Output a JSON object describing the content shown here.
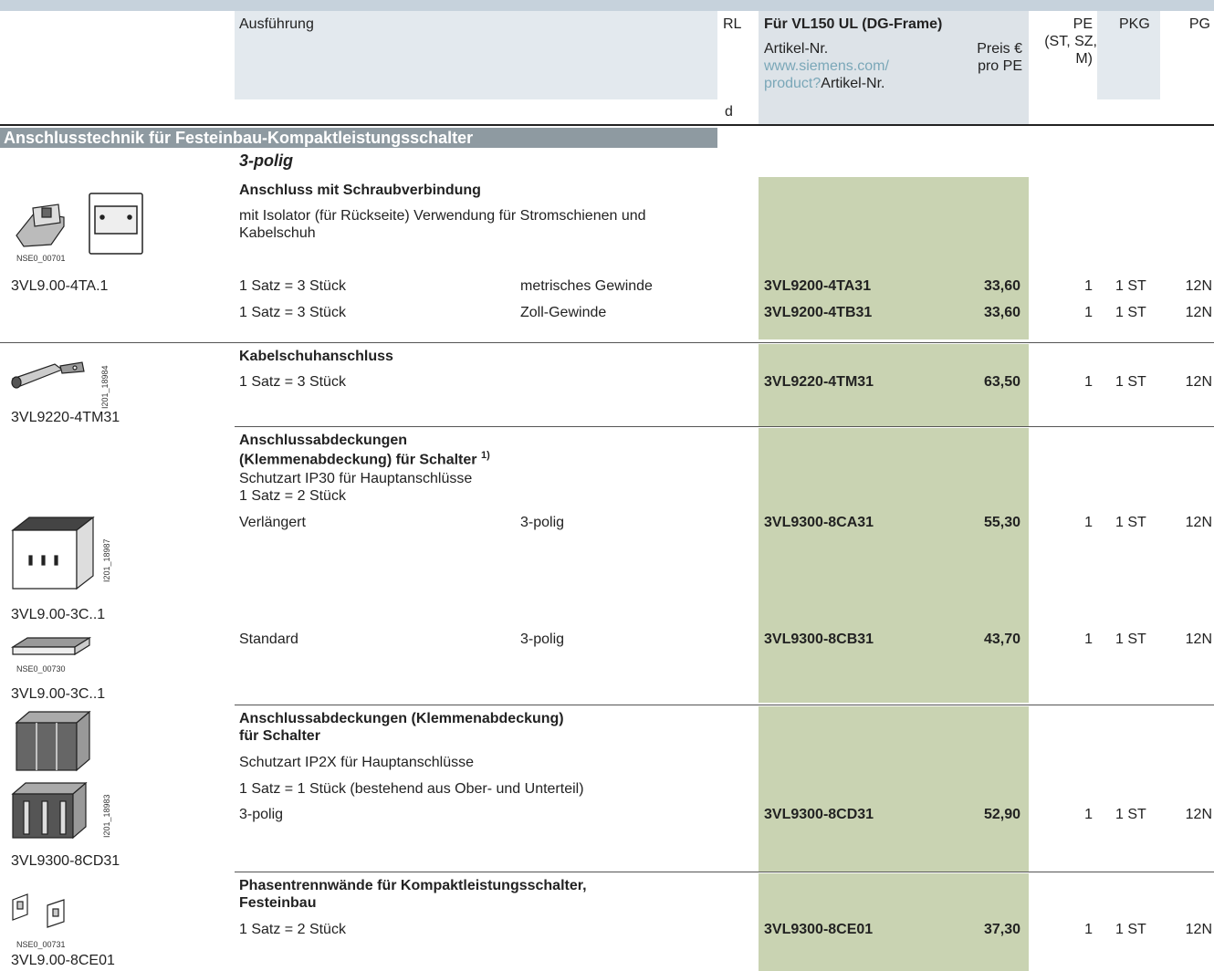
{
  "header": {
    "col_ausfuehrung": "Ausführung",
    "col_rl": "RL",
    "col_rl_d": "d",
    "frame_title": "Für VL150 UL (DG-Frame)",
    "artikel_nr": "Artikel-Nr.",
    "preis_line1": "Preis €",
    "preis_line2": "pro PE",
    "url_line1": "www.siemens.com/",
    "url_line2_link": "product?",
    "url_line2_rest": "Artikel-Nr.",
    "col_pe": "PE",
    "col_pe_sub1": "(ST, SZ,",
    "col_pe_sub2": "M)",
    "col_pkg": "PKG",
    "col_pg": "PG"
  },
  "section": {
    "title": "Anschlusstechnik für Festeinbau-Kompaktleistungsschalter",
    "subtitle": "3-polig"
  },
  "groups": [
    {
      "title": "Anschluss mit Schraubverbindung",
      "desc_line1": "mit Isolator (für Rückseite) Verwendung für Stromschienen und",
      "desc_line2": "Kabelschuh",
      "image_caption": "NSE0_00701",
      "image_label": "3VL9.00-4TA.1",
      "rows": [
        {
          "ausfuehrung": "1 Satz = 3 Stück",
          "variante": "metrisches Gewinde",
          "artikel": "3VL9200-4TA31",
          "preis": "33,60",
          "pe": "1",
          "pkg": "1 ST",
          "pg": "12N"
        },
        {
          "ausfuehrung": "1 Satz = 3 Stück",
          "variante": "Zoll-Gewinde",
          "artikel": "3VL9200-4TB31",
          "preis": "33,60",
          "pe": "1",
          "pkg": "1 ST",
          "pg": "12N"
        }
      ]
    },
    {
      "title": "Kabelschuhanschluss",
      "image_caption": "I201_18984",
      "image_label": "3VL9220-4TM31",
      "rows": [
        {
          "ausfuehrung": "1 Satz = 3 Stück",
          "variante": "",
          "artikel": "3VL9220-4TM31",
          "preis": "63,50",
          "pe": "1",
          "pkg": "1 ST",
          "pg": "12N"
        }
      ]
    },
    {
      "title_line1": "Anschlussabdeckungen",
      "title_line2": "(Klemmenabdeckung) für Schalter",
      "footnote": "1)",
      "desc_line1": "Schutzart IP30 für Hauptanschlüsse",
      "desc_line2": "1 Satz = 2 Stück",
      "image1_caption": "I201_18987",
      "image1_label": "3VL9.00-3C..1",
      "image2_caption": "NSE0_00730",
      "image2_label": "3VL9.00-3C..1",
      "rows": [
        {
          "ausfuehrung": "Verlängert",
          "variante": "3-polig",
          "artikel": "3VL9300-8CA31",
          "preis": "55,30",
          "pe": "1",
          "pkg": "1 ST",
          "pg": "12N"
        },
        {
          "ausfuehrung": "Standard",
          "variante": "3-polig",
          "artikel": "3VL9300-8CB31",
          "preis": "43,70",
          "pe": "1",
          "pkg": "1 ST",
          "pg": "12N"
        }
      ]
    },
    {
      "title_line1": "Anschlussabdeckungen (Klemmenabdeckung)",
      "title_line2": "für Schalter",
      "desc_line1": "Schutzart IP2X für Hauptanschlüsse",
      "desc_line2": "1 Satz = 1 Stück (bestehend aus Ober- und Unterteil)",
      "image_caption": "I201_18983",
      "image_label": "3VL9300-8CD31",
      "rows": [
        {
          "ausfuehrung": "3-polig",
          "variante": "",
          "artikel": "3VL9300-8CD31",
          "preis": "52,90",
          "pe": "1",
          "pkg": "1 ST",
          "pg": "12N"
        }
      ]
    },
    {
      "title_line1": "Phasentrennwände für Kompaktleistungsschalter,",
      "title_line2": "Festeinbau",
      "image_caption": "NSE0_00731",
      "image_label": "3VL9.00-8CE01",
      "rows": [
        {
          "ausfuehrung": "1 Satz = 2 Stück",
          "variante": "",
          "artikel": "3VL9300-8CE01",
          "preis": "37,30",
          "pe": "1",
          "pkg": "1 ST",
          "pg": "12N"
        }
      ]
    }
  ]
}
